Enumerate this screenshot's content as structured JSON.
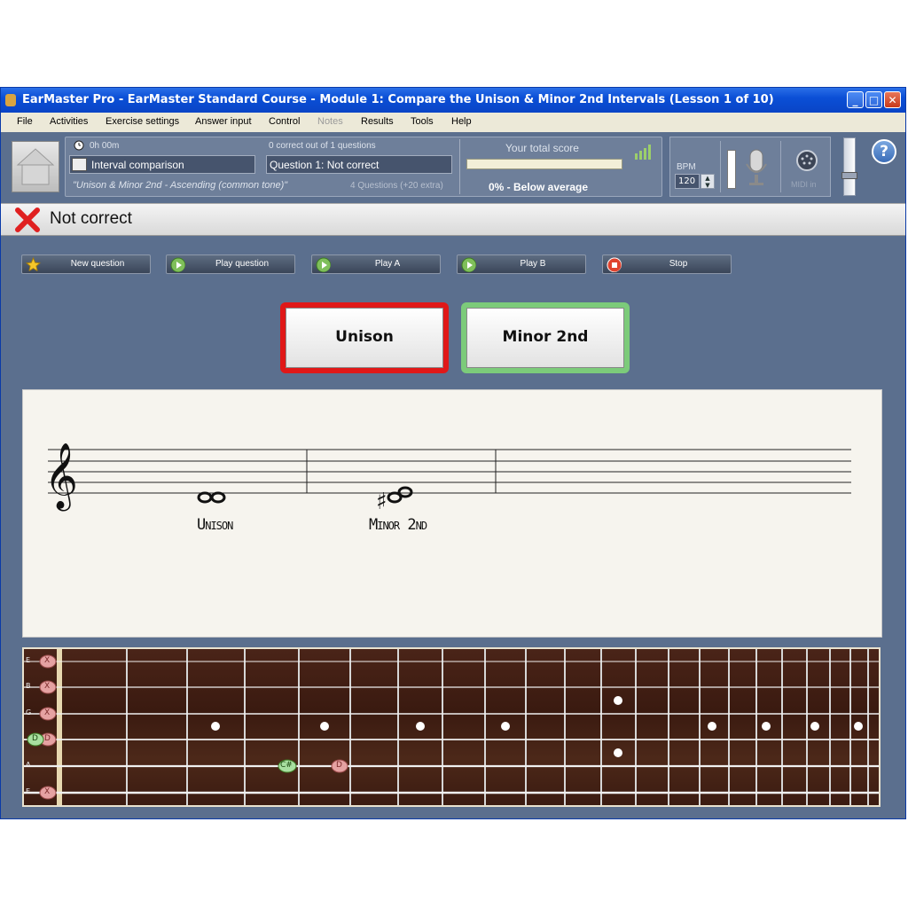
{
  "window": {
    "title": "EarMaster Pro - EarMaster Standard Course - Module 1: Compare the Unison & Minor 2nd Intervals (Lesson 1 of 10)",
    "controls": [
      "_",
      "□",
      "✕"
    ]
  },
  "menu": [
    {
      "label": "File",
      "enabled": true
    },
    {
      "label": "Activities",
      "enabled": true
    },
    {
      "label": "Exercise settings",
      "enabled": true
    },
    {
      "label": "Answer input",
      "enabled": true
    },
    {
      "label": "Control",
      "enabled": true
    },
    {
      "label": "Notes",
      "enabled": false
    },
    {
      "label": "Results",
      "enabled": true
    },
    {
      "label": "Tools",
      "enabled": true
    },
    {
      "label": "Help",
      "enabled": true
    }
  ],
  "info": {
    "timer": "0h 00m",
    "exercise_type": "Interval comparison",
    "exercise_subtitle": "\"Unison & Minor 2nd - Ascending (common tone)\"",
    "progress_text": "0 correct out of 1 questions",
    "question_status": "Question 1: Not correct",
    "questions_count": "4 Questions (+20 extra)",
    "score_label": "Your total score",
    "score_value": "0% - Below average",
    "score_fraction": 0
  },
  "controls": {
    "bpm_label": "BPM",
    "bpm_value": "120",
    "midi_label": "MIDI in",
    "help": "?"
  },
  "status": {
    "text": "Not correct",
    "icon": "x-icon",
    "color": "#e02020"
  },
  "actions": [
    {
      "label": "New question",
      "icon": "star-icon"
    },
    {
      "label": "Play question",
      "icon": "play-question-icon"
    },
    {
      "label": "Play A",
      "icon": "play-a-icon"
    },
    {
      "label": "Play B",
      "icon": "play-b-icon"
    },
    {
      "label": "Stop",
      "icon": "stop-icon"
    }
  ],
  "answers": [
    {
      "label": "Unison",
      "state": "wrong",
      "color": "#e01818"
    },
    {
      "label": "Minor 2nd",
      "state": "correct",
      "color": "#7ccb7a"
    }
  ],
  "score_sheet": {
    "labels": [
      "Unison",
      "Minor 2nd"
    ]
  },
  "fretboard": {
    "strings": [
      "E",
      "B",
      "G",
      "D",
      "A",
      "E"
    ],
    "open_markers": [
      {
        "string": "E",
        "text": "X"
      },
      {
        "string": "B",
        "text": "X"
      },
      {
        "string": "G",
        "text": "X"
      },
      {
        "string": "D",
        "text": "D"
      },
      {
        "string": "D",
        "text": "D"
      },
      {
        "string": "E",
        "text": "X"
      }
    ],
    "notes": [
      {
        "string": "A",
        "text": "C#"
      },
      {
        "string": "A",
        "text": "D"
      }
    ]
  }
}
